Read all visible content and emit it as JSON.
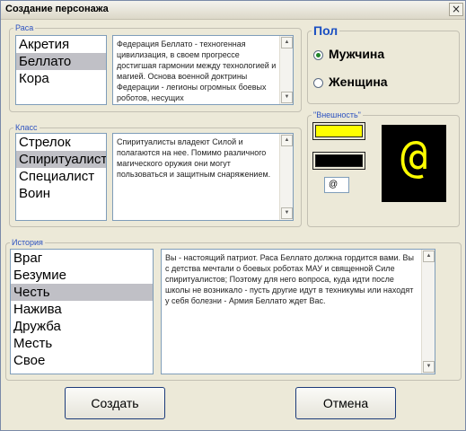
{
  "window": {
    "title": "Создание персонажа",
    "close_symbol": "×"
  },
  "race": {
    "legend": "Раса",
    "items": [
      "Акретия",
      "Беллато",
      "Кора"
    ],
    "selected_index": 1,
    "description": "Федерация Беллато - техногенная цивилизация, в своем прогрессе достигшая гармонии между технологией и магией. Основа военной доктрины Федерации - легионы огромных боевых роботов, несущих"
  },
  "class": {
    "legend": "Класс",
    "items": [
      "Стрелок",
      "Спиритуалист",
      "Специалист",
      "Воин"
    ],
    "selected_index": 1,
    "description": "Спиритуалисты владеют Силой и полагаются на нее. Помимо различного магического оружия они могут пользоваться и защитным снаряжением."
  },
  "gender": {
    "legend": "Пол",
    "options": [
      "Мужчина",
      "Женщина"
    ],
    "selected_index": 0
  },
  "appearance": {
    "legend": "\"Внешность\"",
    "fg_color": "#ffff00",
    "bg_color": "#000000",
    "symbol": "@"
  },
  "history": {
    "legend": "История",
    "items": [
      "Враг",
      "Безумие",
      "Честь",
      "Нажива",
      "Дружба",
      "Месть",
      "Свое"
    ],
    "selected_index": 2,
    "description": "Вы - настоящий патриот. Раса Беллато должна гордится вами. Вы с детства мечтали о боевых роботах МАУ и священной Силе спиритуалистов; Поэтому для него вопроса, куда идти после школы не возникало - пусть другие идут в техникумы или находят у себя болезни - Армия Беллато ждет Вас."
  },
  "buttons": {
    "create": "Создать",
    "cancel": "Отмена"
  },
  "scroll": {
    "up": "▲",
    "down": "▼"
  }
}
